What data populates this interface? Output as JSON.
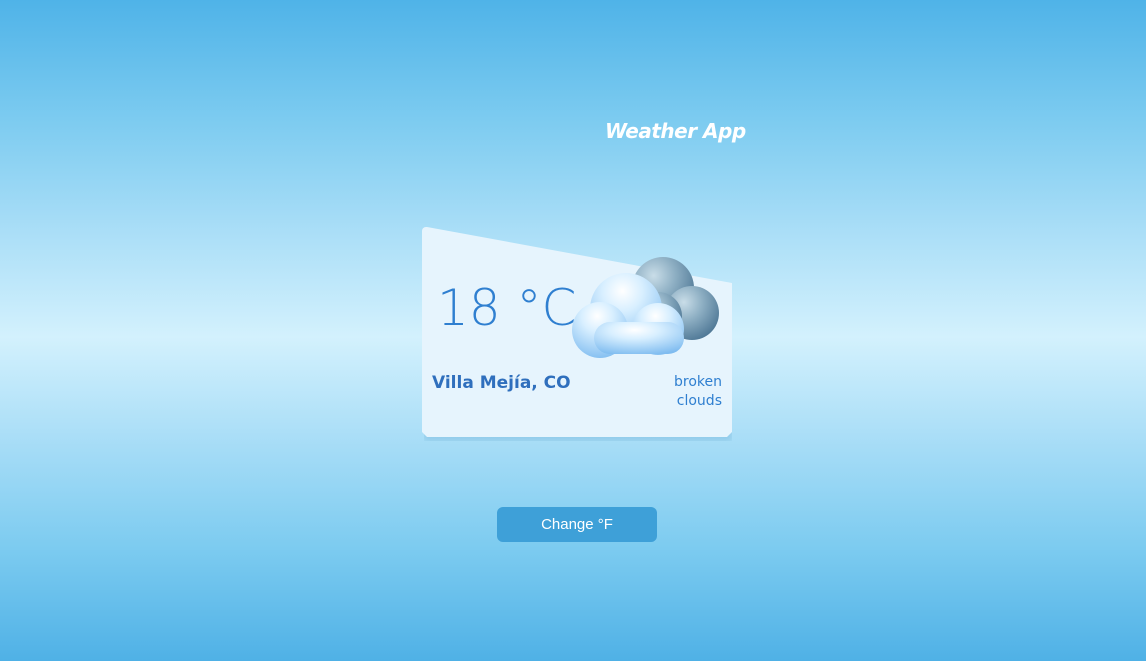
{
  "header": {
    "title": "Weather App"
  },
  "weather": {
    "temperature": "18 °C",
    "location": "Villa Mejía, CO",
    "description": "broken clouds",
    "icon": "broken-clouds-icon"
  },
  "controls": {
    "change_unit_label": "Change °F"
  },
  "colors": {
    "accent_text": "#2f7fd0",
    "button_bg": "#3ea0d8",
    "card_bg": "#e6f4fd"
  }
}
